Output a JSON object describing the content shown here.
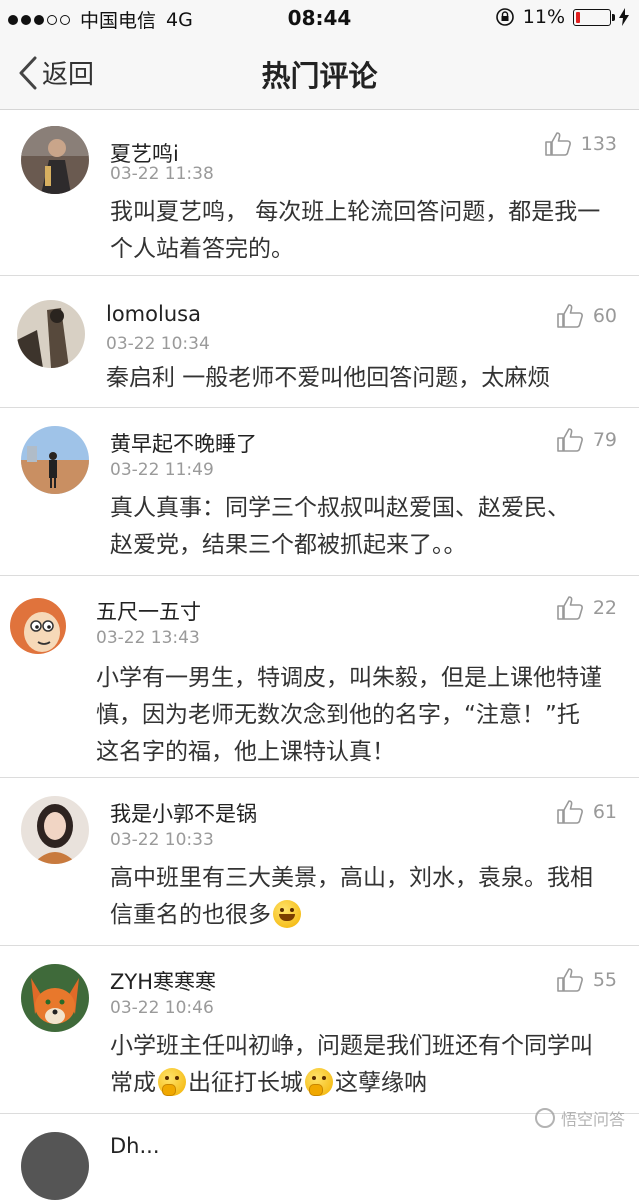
{
  "status_bar": {
    "carrier": "中国电信",
    "network": "4G",
    "time": "08:44",
    "battery": "11%",
    "battery_level": 0.11,
    "battery_color": "#e02020"
  },
  "nav": {
    "back_label": "返回",
    "title": "热门评论"
  },
  "comments": [
    {
      "user": "夏艺鸣i",
      "date": "03-22 11:38",
      "likes": "133",
      "text": "我叫夏艺鸣， 每次班上轮流回答问题，都是我一个人站着答完的。"
    },
    {
      "user": "lomolusa",
      "date": "03-22 10:34",
      "likes": "60",
      "text": "秦启利 一般老师不爱叫他回答问题，太麻烦"
    },
    {
      "user": "黄早起不晚睡了",
      "date": "03-22 11:49",
      "likes": "79",
      "text": "真人真事：同学三个叔叔叫赵爱国、赵爱民、赵爱党，结果三个都被抓起来了。。"
    },
    {
      "user": "五尺一五寸",
      "date": "03-22 13:43",
      "likes": "22",
      "text": "小学有一男生，特调皮，叫朱毅，但是上课他特谨慎，因为老师无数次念到他的名字，“注意！”托这名字的福，他上课特认真！"
    },
    {
      "user": "我是小郭不是锅",
      "date": "03-22 10:33",
      "likes": "61",
      "text_a": "高中班里有三大美景，高山，刘水，袁泉。我相信重名的也很多",
      "emoji_a": "grin-emoji"
    },
    {
      "user": "ZYH寒寒寒",
      "date": "03-22 10:46",
      "likes": "55",
      "text_a": "小学班主任叫初峥，问题是我们班还有个同学叫常成",
      "text_b": "出征打长城",
      "text_c": "这孽缘呐",
      "emoji": "thinking-emoji"
    },
    {
      "user": "Dh..."
    }
  ],
  "watermark": "悟空问答"
}
